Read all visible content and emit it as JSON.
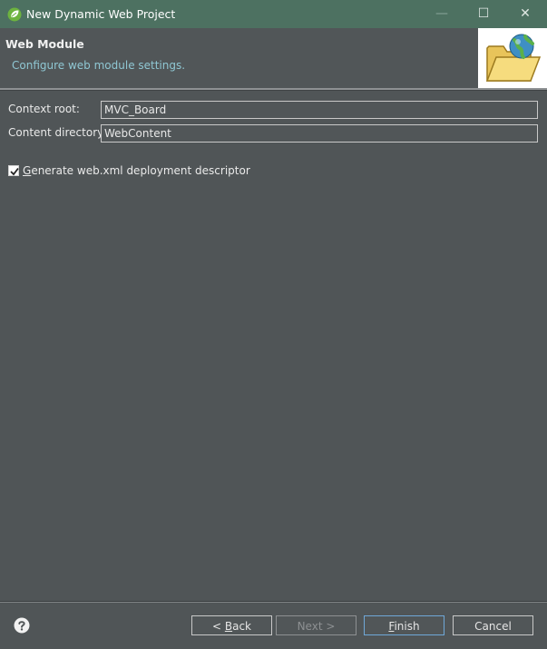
{
  "window": {
    "title": "New Dynamic Web Project",
    "controls": {
      "minimize": "—",
      "maximize": "☐",
      "close": "✕"
    }
  },
  "header": {
    "title": "Web Module",
    "description": "Configure web module settings.",
    "banner_icon": "folder-globe-icon"
  },
  "form": {
    "context_root_label": "Context root:",
    "context_root_value": "MVC_Board",
    "content_directory_label": "Content directory:",
    "content_directory_value": "WebContent",
    "generate_checkbox": {
      "mnemonic": "G",
      "label_rest": "enerate web.xml deployment descriptor",
      "checked": true
    }
  },
  "footer": {
    "help_icon": "help-icon",
    "back_prefix": "< ",
    "back_mnemonic": "B",
    "back_rest": "ack",
    "next_label": "Next >",
    "finish_mnemonic": "F",
    "finish_rest": "inish",
    "cancel_label": "Cancel"
  },
  "colors": {
    "titlebar": "#4d7161",
    "background": "#505557",
    "description_text": "#8fc7d3",
    "default_button_border": "#6fa8d8"
  }
}
